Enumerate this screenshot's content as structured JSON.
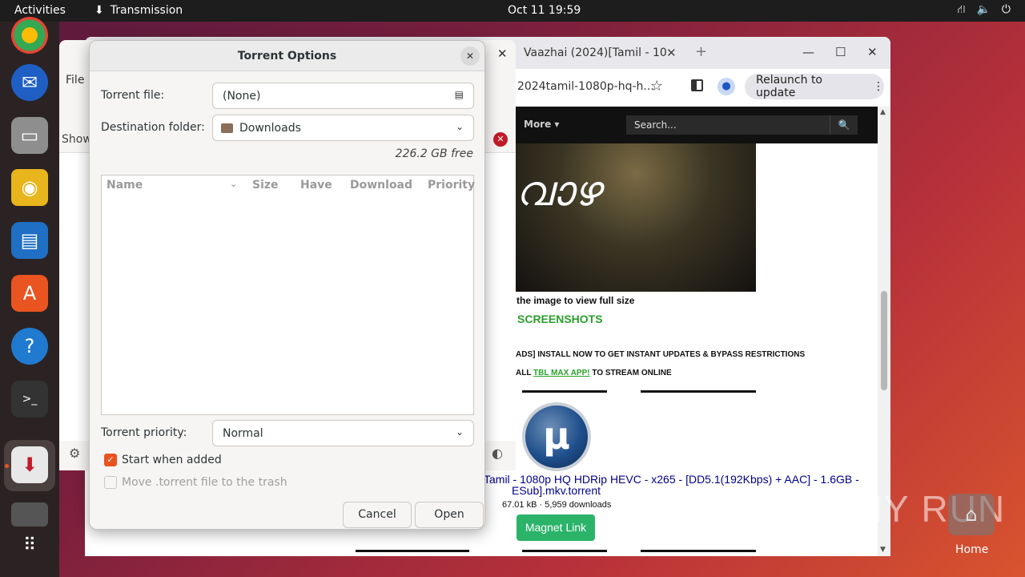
{
  "topbar": {
    "activities": "Activities",
    "app_name": "Transmission",
    "clock": "Oct 11  19:59"
  },
  "dock": {
    "icons": [
      "chrome-icon",
      "thunderbird-icon",
      "files-icon",
      "rhythmbox-icon",
      "writer-icon",
      "software-icon",
      "help-icon",
      "terminal-icon",
      "transmission-icon",
      "drive-icon",
      "apps-grid-icon"
    ]
  },
  "browser": {
    "tab_title": "Vaazhai (2024)[Tamil - 10",
    "url": "2024tamil-1080p-hq-h...",
    "relaunch": "Relaunch to update",
    "nav_more": "More ▾",
    "search_placeholder": "Search...",
    "poster_text": "വാഴ",
    "click_hint": "the image to view full size",
    "screenshots": "SCREENSHOTS",
    "install_line": "ADS] INSTALL NOW TO GET INSTANT UPDATES & BYPASS RESTRICTIONS",
    "stream_prefix": "ALL ",
    "stream_link": "TBL MAX APP!",
    "stream_suffix": "  TO STREAM ONLINE",
    "torrent_name_1": "Tamil - 1080p HQ HDRip HEVC - x265 - [DD5.1(192Kbps) + AAC] - 1.6GB -",
    "torrent_name_2": "ESub].mkv.torrent",
    "torrent_meta": "67.01 kB · 5,959 downloads",
    "magnet": "Magnet Link"
  },
  "transmission_main": {
    "file_menu": "File",
    "show_label": "Show"
  },
  "dialog": {
    "title": "Torrent Options",
    "torrent_file_label": "Torrent file:",
    "torrent_file_value": "(None)",
    "destination_label": "Destination folder:",
    "destination_value": "Downloads",
    "free_space": "226.2 GB free",
    "columns": {
      "name": "Name",
      "size": "Size",
      "have": "Have",
      "download": "Download",
      "priority": "Priority"
    },
    "priority_label": "Torrent priority:",
    "priority_value": "Normal",
    "start_when_added": "Start when added",
    "start_when_added_checked": true,
    "move_to_trash": "Move .torrent file to the trash",
    "move_to_trash_checked": false,
    "cancel": "Cancel",
    "open": "Open"
  },
  "desktop": {
    "watermark": "ANY RUN",
    "home_label": "Home"
  },
  "colors": {
    "accent": "#e95420",
    "magnet_green": "#2bb36a",
    "link_blue": "#00008b",
    "screenshots_green": "#2aa02a"
  }
}
